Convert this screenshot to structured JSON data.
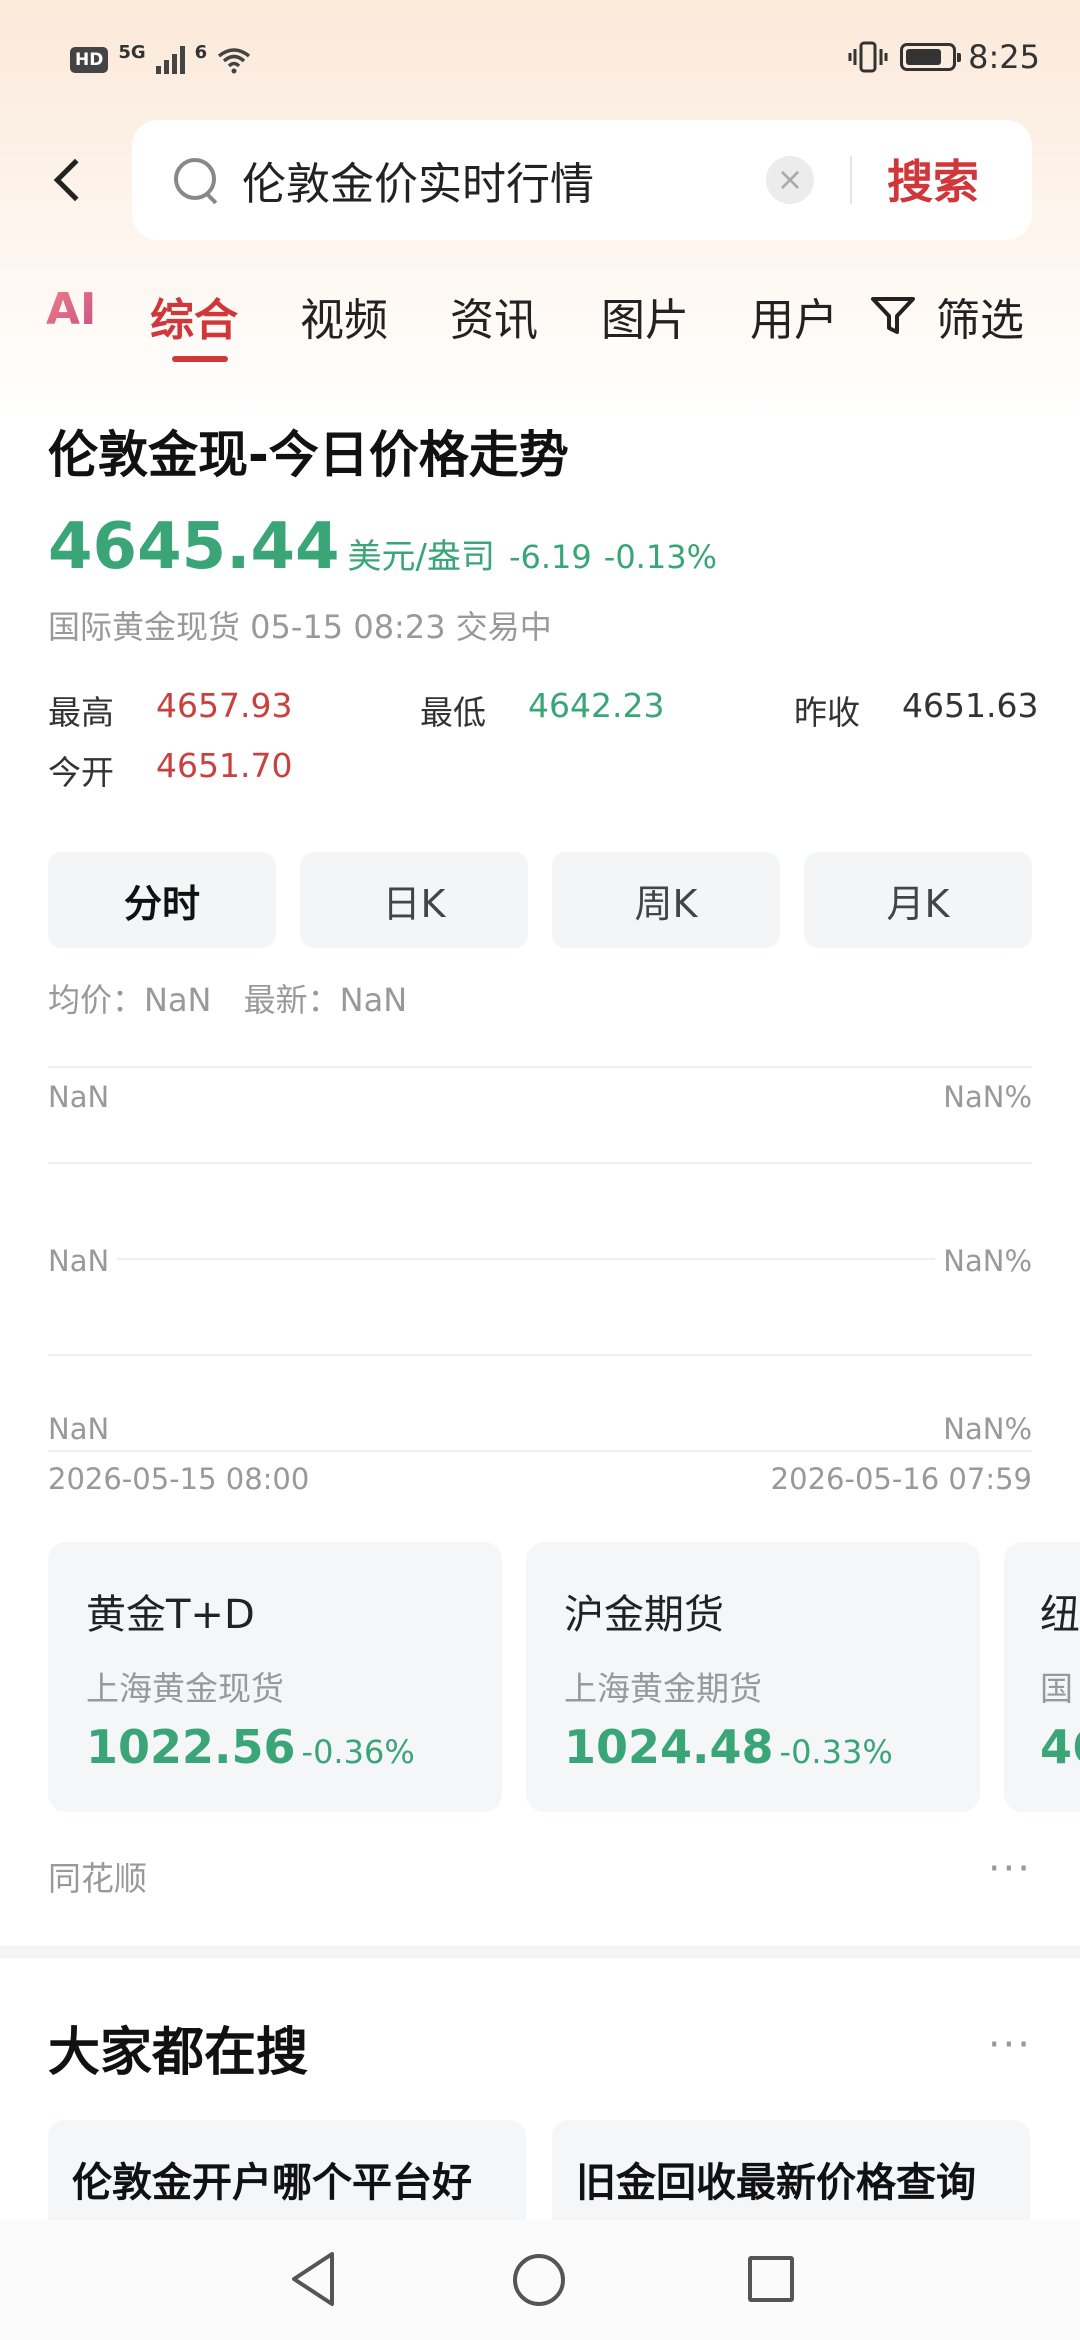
{
  "status_bar": {
    "hd": "HD",
    "network": "5G",
    "wifi_badge": "6",
    "time": "8:25",
    "battery_level": 0.8
  },
  "search": {
    "query": "伦敦金价实时行情",
    "clear_symbol": "×",
    "submit_label": "搜索"
  },
  "tabs": {
    "ai": "AI",
    "items": [
      "综合",
      "视频",
      "资讯",
      "图片",
      "用户"
    ],
    "active": "综合",
    "filter_label": "筛选"
  },
  "quote": {
    "title": "伦敦金现-今日价格走势",
    "price": "4645.44",
    "unit": "美元/盎司",
    "change": "-6.19",
    "change_pct": "-0.13%",
    "info": "国际黄金现货 05-15 08:23 交易中",
    "high_label": "最高",
    "high": "4657.93",
    "low_label": "最低",
    "low": "4642.23",
    "prev_close_label": "昨收",
    "prev_close": "4651.63",
    "open_label": "今开",
    "open": "4651.70"
  },
  "periods": [
    "分时",
    "日K",
    "周K",
    "月K"
  ],
  "active_period": "分时",
  "chart": {
    "avg_label": "均价：NaN",
    "latest_label": "最新：NaN",
    "left_labels": [
      "NaN",
      "NaN",
      "NaN"
    ],
    "right_labels": [
      "NaN%",
      "NaN%",
      "NaN%"
    ],
    "time_start": "2026-05-15 08:00",
    "time_end": "2026-05-16 07:59"
  },
  "markets": [
    {
      "name": "黄金T+D",
      "sub": "上海黄金现货",
      "price": "1022.56",
      "change": "-0.36%"
    },
    {
      "name": "沪金期货",
      "sub": "上海黄金期货",
      "price": "1024.48",
      "change": "-0.33%"
    },
    {
      "name": "纽",
      "sub": "国",
      "price": "46",
      "change": ""
    }
  ],
  "source": "同花顺",
  "more": "···",
  "hot_search": {
    "title": "大家都在搜",
    "items": [
      "伦敦金开户哪个平台好",
      "旧金回收最新价格查询"
    ]
  },
  "colors": {
    "accent_red": "#d0373a",
    "up_red": "#c9413f",
    "down_green": "#3aa577"
  }
}
